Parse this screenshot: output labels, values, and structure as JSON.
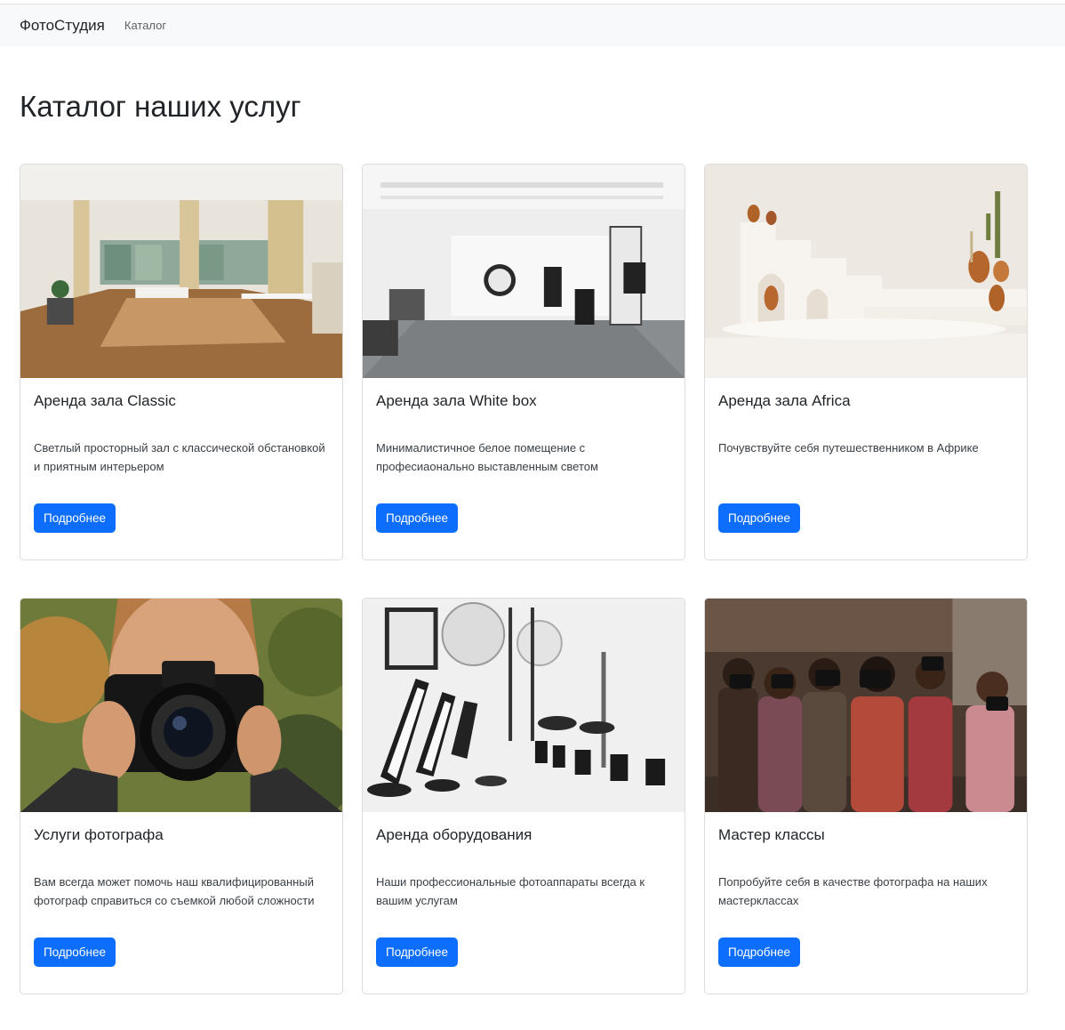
{
  "navbar": {
    "brand": "ФотоСтудия",
    "link": "Каталог"
  },
  "page": {
    "title": "Каталог наших услуг"
  },
  "cards": [
    {
      "title": "Аренда зала Classic",
      "text": "Светлый просторный зал с классической обстановкой и приятным интерьером",
      "button": "Подробнее",
      "image": "classic-hall-photo"
    },
    {
      "title": "Аренда зала White box",
      "text": "Минималистичное белое помещение с професиаонально выставленным светом",
      "button": "Подробнее",
      "image": "white-box-hall-photo"
    },
    {
      "title": "Аренда зала Africa",
      "text": "Почувствуйте себя путешественником в Африке",
      "button": "Подробнее",
      "image": "africa-hall-photo"
    },
    {
      "title": "Услуги фотографа",
      "text": "Вам всегда может помочь наш квалифицированный фотограф справиться со съемкой любой сложности",
      "button": "Подробнее",
      "image": "photographer-photo"
    },
    {
      "title": "Аренда оборудования",
      "text": "Наши профессиональные фотоаппараты всегда к вашим услугам",
      "button": "Подробнее",
      "image": "equipment-photo"
    },
    {
      "title": "Мастер классы",
      "text": "Попробуйте себя в качестве фотографа на наших мастерклассах",
      "button": "Подробнее",
      "image": "master-class-photo"
    }
  ]
}
